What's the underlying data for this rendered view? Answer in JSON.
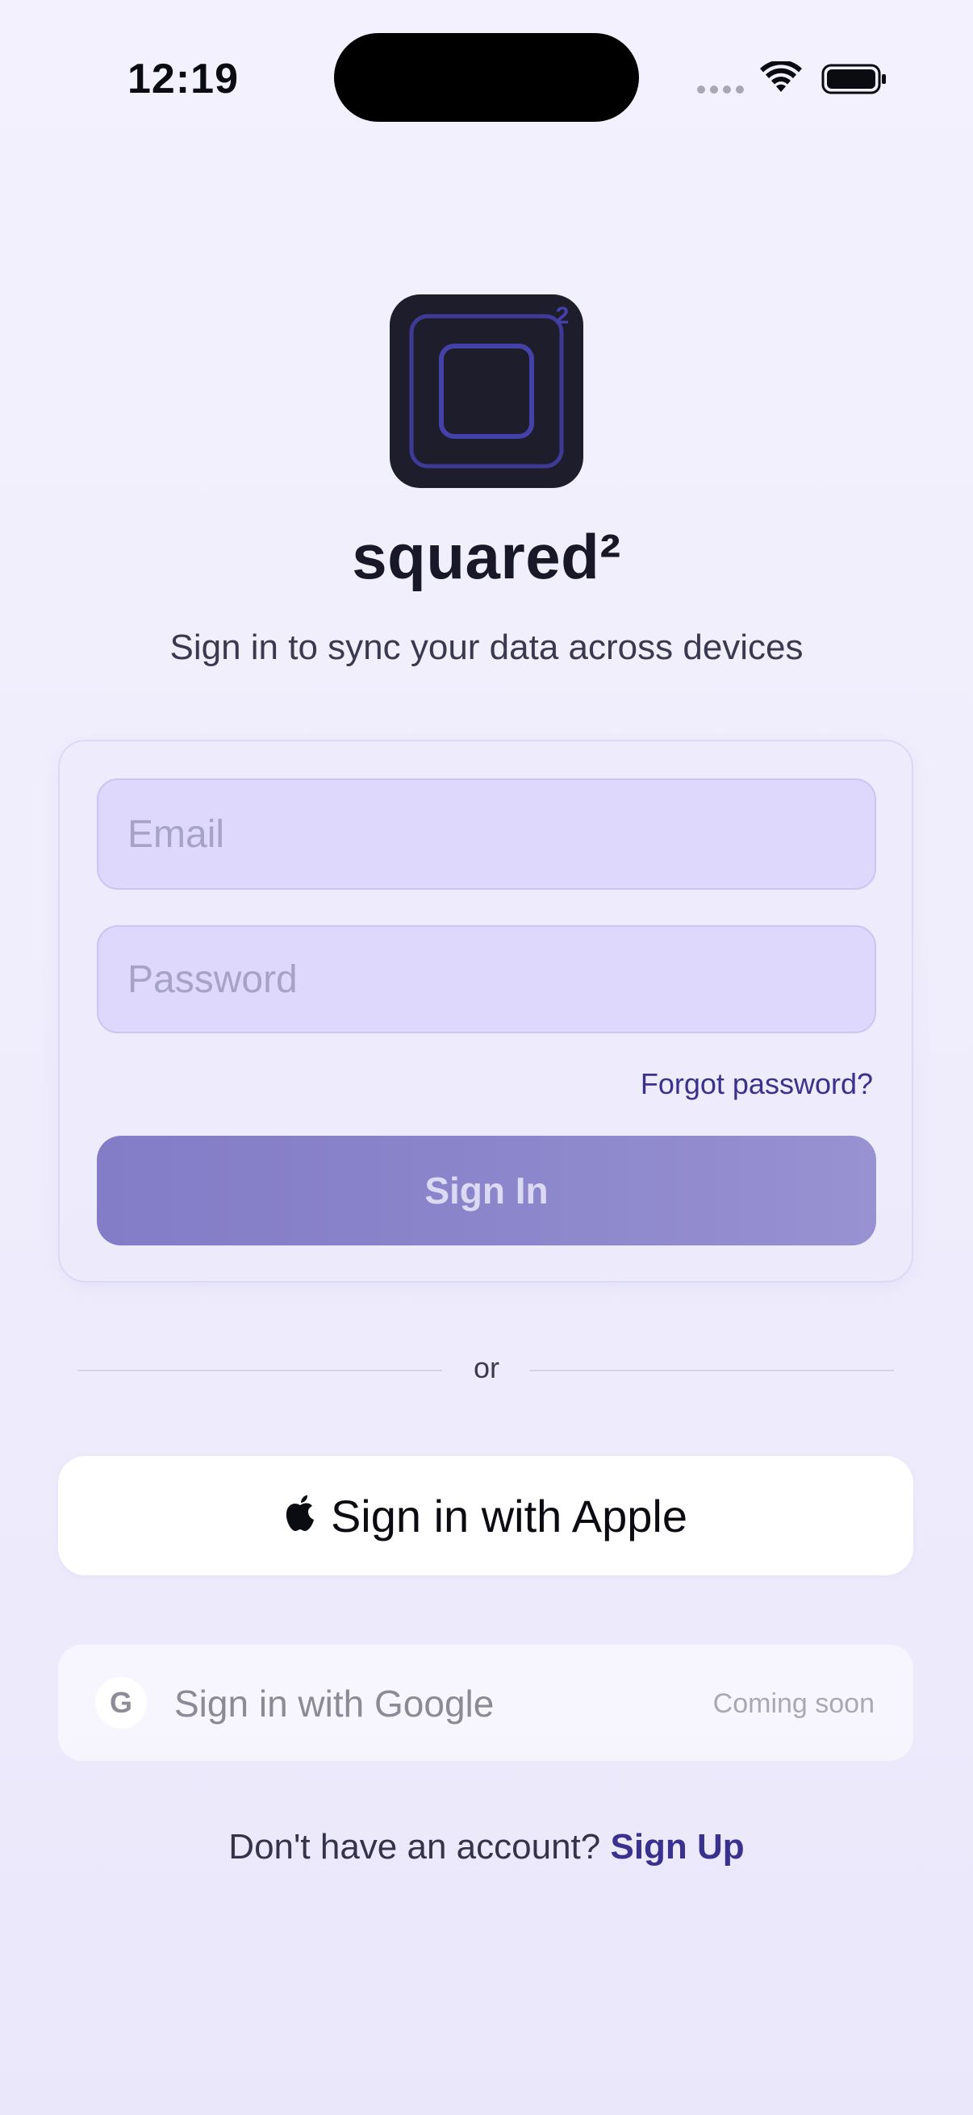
{
  "status_bar": {
    "time": "12:19",
    "icons": [
      "cellular-dots-icon",
      "wifi-icon",
      "battery-icon"
    ]
  },
  "app": {
    "logo_icon": "squared-logo-icon",
    "title": "squared²",
    "subtitle": "Sign in to sync your data across devices"
  },
  "form": {
    "email_placeholder": "Email",
    "password_placeholder": "Password",
    "forgot_password_label": "Forgot password?",
    "signin_label": "Sign In"
  },
  "divider": {
    "label": "or"
  },
  "apple_button": {
    "icon": "apple-logo-icon",
    "label": "Sign in with Apple"
  },
  "google_button": {
    "icon_glyph": "G",
    "label": "Sign in with Google",
    "badge": "Coming soon"
  },
  "signup": {
    "prompt": "Don't have an account?",
    "link_label": "Sign Up"
  },
  "colors": {
    "accent": "#3a318f",
    "signin_button": "#8780c9",
    "field_background": "#ddd8fc",
    "logo_background": "#1e1d2b",
    "logo_stroke": "#3d3a98"
  }
}
